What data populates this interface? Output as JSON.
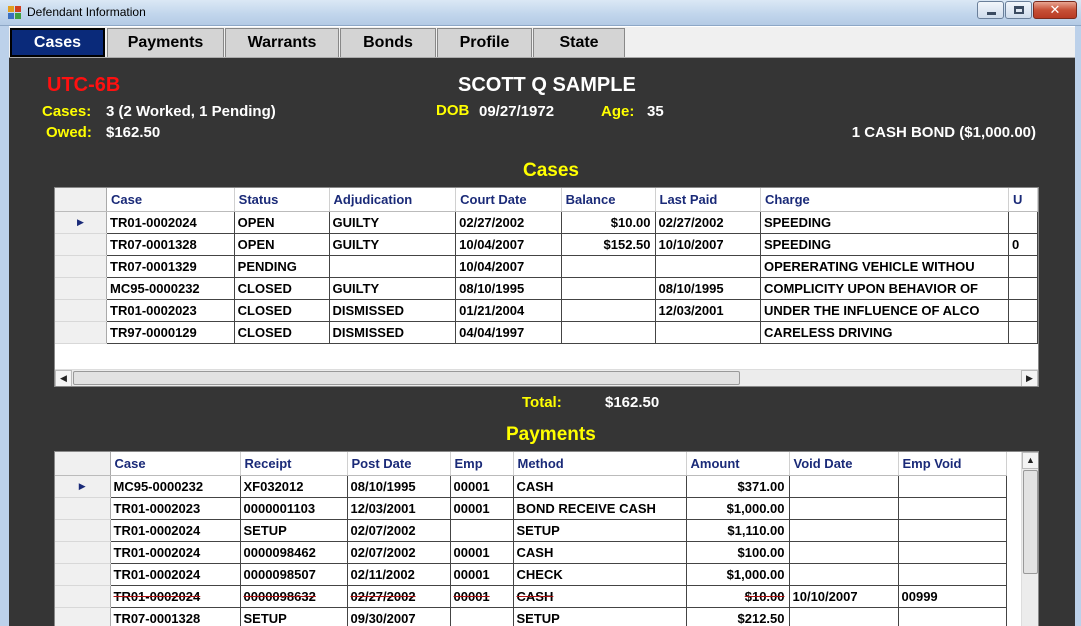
{
  "window": {
    "title": "Defendant Information"
  },
  "tabs": [
    "Cases",
    "Payments",
    "Warrants",
    "Bonds",
    "Profile",
    "State"
  ],
  "header": {
    "court_code": "UTC-6B",
    "defendant_name": "SCOTT Q SAMPLE",
    "cases_label": "Cases:",
    "cases_value": "3 (2 Worked, 1 Pending)",
    "dob_label": "DOB",
    "dob_value": "09/27/1972",
    "age_label": "Age:",
    "age_value": "35",
    "owed_label": "Owed:",
    "owed_value": "$162.50",
    "bond_summary": "1 CASH BOND ($1,000.00)"
  },
  "cases": {
    "heading": "Cases",
    "columns": [
      "Case",
      "Status",
      "Adjudication",
      "Court Date",
      "Balance",
      "Last Paid",
      "Charge",
      "U"
    ],
    "rows": [
      {
        "case": "TR01-0002024",
        "status": "OPEN",
        "adjudication": "GUILTY",
        "court_date": "02/27/2002",
        "balance": "$10.00",
        "last_paid": "02/27/2002",
        "charge": "SPEEDING",
        "extra": "",
        "status_style": "open",
        "current": true
      },
      {
        "case": "TR07-0001328",
        "status": "OPEN",
        "adjudication": "GUILTY",
        "court_date": "10/04/2007",
        "balance": "$152.50",
        "last_paid": "10/10/2007",
        "charge": "SPEEDING",
        "extra": "0",
        "status_style": "open",
        "current": false
      },
      {
        "case": "TR07-0001329",
        "status": "PENDING",
        "adjudication": "",
        "court_date": "10/04/2007",
        "balance": "",
        "last_paid": "",
        "charge": "OPERERATING VEHICLE WITHOU",
        "extra": "",
        "status_style": "pending",
        "current": false
      },
      {
        "case": "MC95-0000232",
        "status": "CLOSED",
        "adjudication": "GUILTY",
        "court_date": "08/10/1995",
        "balance": "",
        "last_paid": "08/10/1995",
        "charge": "COMPLICITY UPON BEHAVIOR OF",
        "extra": "",
        "status_style": "closed",
        "current": false
      },
      {
        "case": "TR01-0002023",
        "status": "CLOSED",
        "adjudication": "DISMISSED",
        "court_date": "01/21/2004",
        "balance": "",
        "last_paid": "12/03/2001",
        "charge": "UNDER THE INFLUENCE OF ALCO",
        "extra": "",
        "status_style": "closed",
        "current": false
      },
      {
        "case": "TR97-0000129",
        "status": "CLOSED",
        "adjudication": "DISMISSED",
        "court_date": "04/04/1997",
        "balance": "",
        "last_paid": "",
        "charge": "CARELESS DRIVING",
        "extra": "",
        "status_style": "closed",
        "current": false
      }
    ],
    "total_label": "Total:",
    "total_value": "$162.50"
  },
  "payments": {
    "heading": "Payments",
    "columns": [
      "Case",
      "Receipt",
      "Post Date",
      "Emp",
      "Method",
      "Amount",
      "Void Date",
      "Emp Void"
    ],
    "rows": [
      {
        "case": "MC95-0000232",
        "receipt": "XF032012",
        "post_date": "08/10/1995",
        "emp": "00001",
        "method": "CASH",
        "amount": "$371.00",
        "void_date": "",
        "emp_void": "",
        "style": "normal",
        "current": true
      },
      {
        "case": "TR01-0002023",
        "receipt": "0000001103",
        "post_date": "12/03/2001",
        "emp": "00001",
        "method": "BOND RECEIVE CASH",
        "amount": "$1,000.00",
        "void_date": "",
        "emp_void": "",
        "style": "normal",
        "current": false
      },
      {
        "case": "TR01-0002024",
        "receipt": "SETUP",
        "post_date": "02/07/2002",
        "emp": "",
        "method": "SETUP",
        "amount": "$1,110.00",
        "void_date": "",
        "emp_void": "",
        "style": "setup",
        "current": false
      },
      {
        "case": "TR01-0002024",
        "receipt": "0000098462",
        "post_date": "02/07/2002",
        "emp": "00001",
        "method": "CASH",
        "amount": "$100.00",
        "void_date": "",
        "emp_void": "",
        "style": "muted",
        "current": false
      },
      {
        "case": "TR01-0002024",
        "receipt": "0000098507",
        "post_date": "02/11/2002",
        "emp": "00001",
        "method": "CHECK",
        "amount": "$1,000.00",
        "void_date": "",
        "emp_void": "",
        "style": "muted",
        "current": false
      },
      {
        "case": "TR01-0002024",
        "receipt": "0000098632",
        "post_date": "02/27/2002",
        "emp": "00001",
        "method": "CASH",
        "amount": "$10.00",
        "void_date": "10/10/2007",
        "emp_void": "00999",
        "style": "voided",
        "current": false
      },
      {
        "case": "TR07-0001328",
        "receipt": "SETUP",
        "post_date": "09/30/2007",
        "emp": "",
        "method": "SETUP",
        "amount": "$212.50",
        "void_date": "",
        "emp_void": "",
        "style": "setup",
        "current": false
      }
    ]
  },
  "icons": {
    "row_pointer": "row-pointer-icon",
    "scroll_left": "scroll-left-icon",
    "scroll_right": "scroll-right-icon",
    "scroll_up": "scroll-up-icon"
  },
  "colors": {
    "panel_bg": "#353535",
    "accent_yellow": "#ffff00",
    "court_red": "#ff1010",
    "active_tab": "#0a2a7a",
    "header_blue": "#1a2a78"
  }
}
